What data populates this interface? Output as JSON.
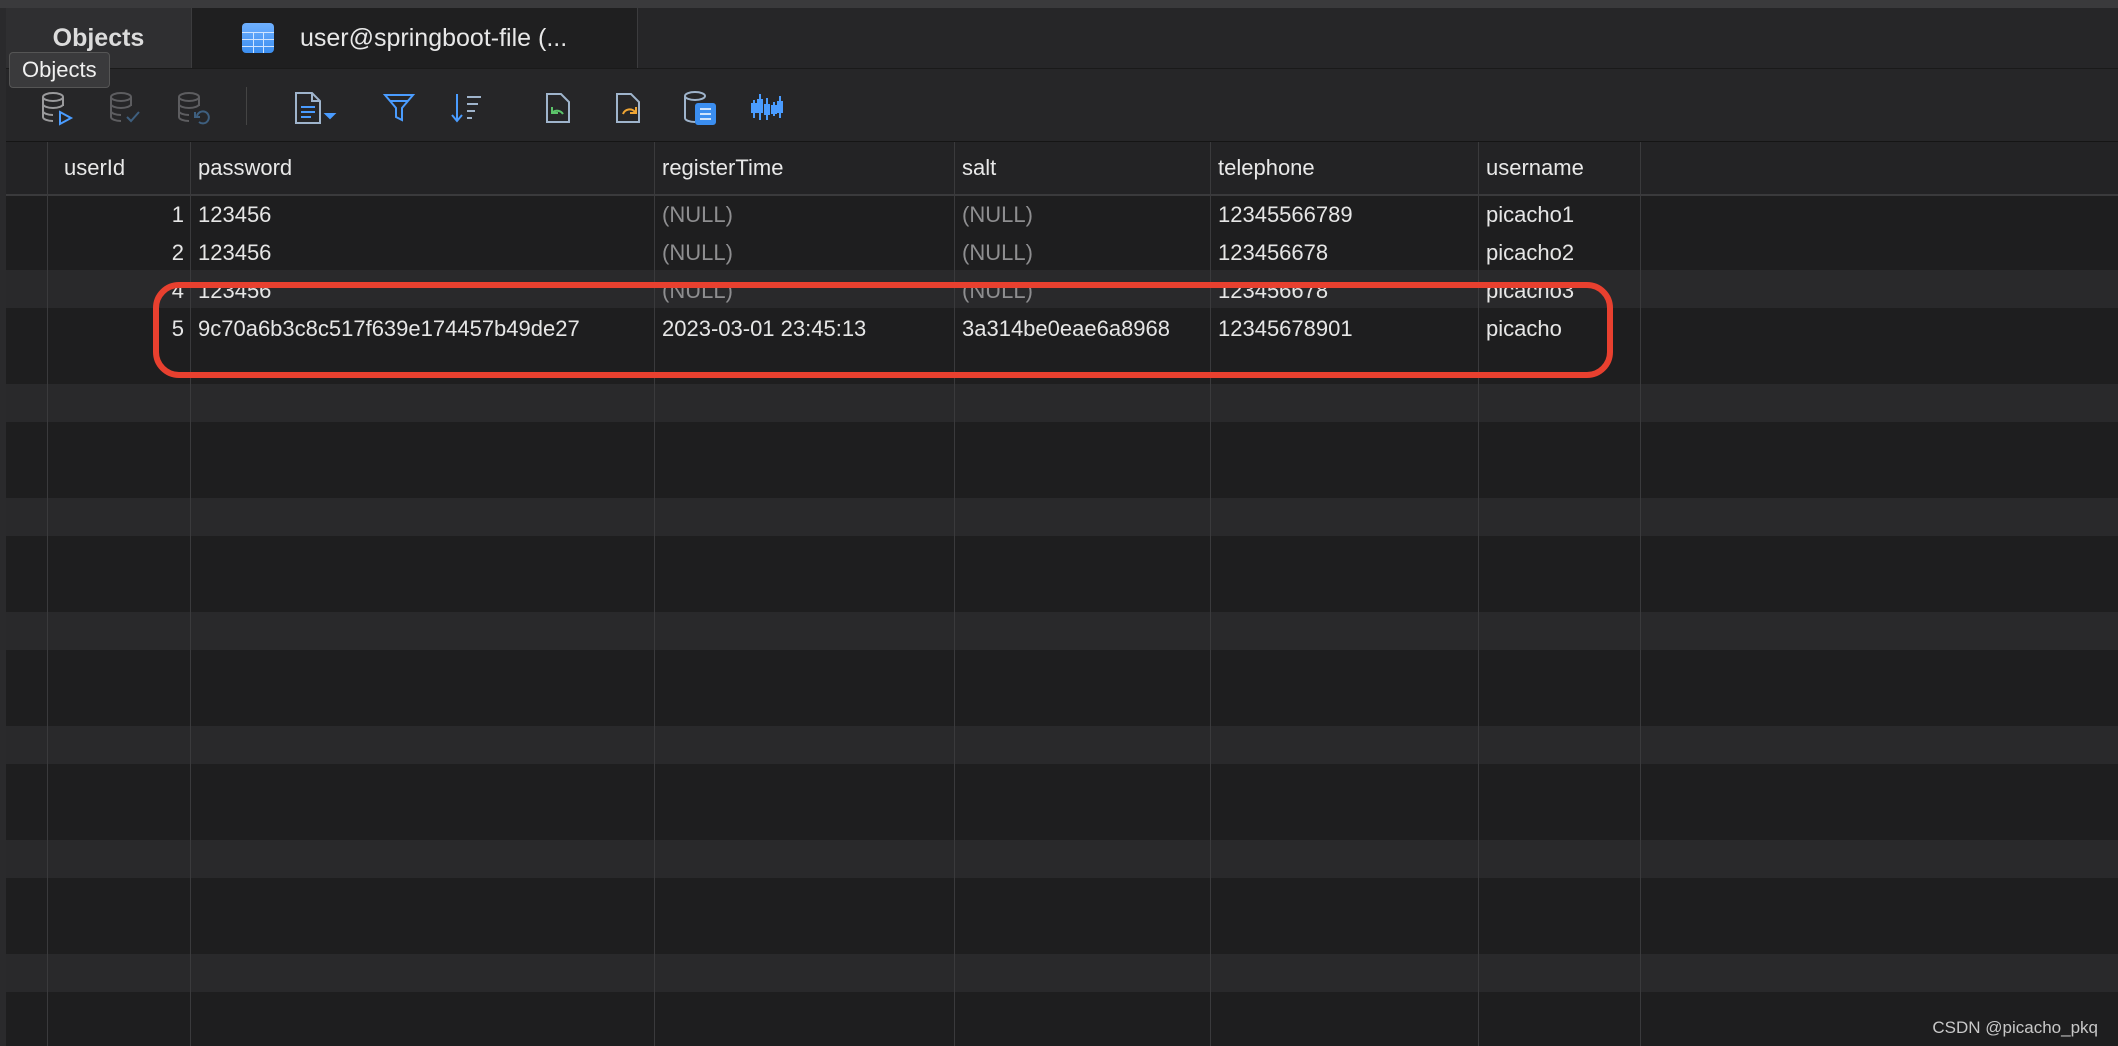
{
  "tabs": [
    {
      "label": "Objects"
    },
    {
      "label": "user@springboot-file (..."
    }
  ],
  "tooltip": "Objects",
  "toolbar": [
    {
      "icon": "db-run-icon"
    },
    {
      "icon": "db-commit-icon"
    },
    {
      "icon": "db-rollback-icon"
    },
    {
      "icon": "text-view-icon"
    },
    {
      "icon": "filter-icon"
    },
    {
      "icon": "sort-icon"
    },
    {
      "icon": "import-icon"
    },
    {
      "icon": "export-icon"
    },
    {
      "icon": "data-generation-icon"
    },
    {
      "icon": "chart-icon"
    }
  ],
  "table": {
    "columns": [
      "userId",
      "password",
      "registerTime",
      "salt",
      "telephone",
      "username"
    ],
    "rows": [
      [
        "1",
        "123456",
        "(NULL)",
        "(NULL)",
        "12345566789",
        "picacho1"
      ],
      [
        "2",
        "123456",
        "(NULL)",
        "(NULL)",
        "123456678",
        "picacho2"
      ],
      [
        "4",
        "123456",
        "(NULL)",
        "(NULL)",
        "123456678",
        "picacho3"
      ],
      [
        "5",
        "9c70a6b3c8c517f639e174457b49de27",
        "2023-03-01 23:45:13",
        "3a314be0eae6a8968",
        "12345678901",
        "picacho"
      ]
    ]
  },
  "colors": {
    "highlight": "#e8402f",
    "accent": "#3b8ef0"
  },
  "watermark": "CSDN @picacho_pkq"
}
